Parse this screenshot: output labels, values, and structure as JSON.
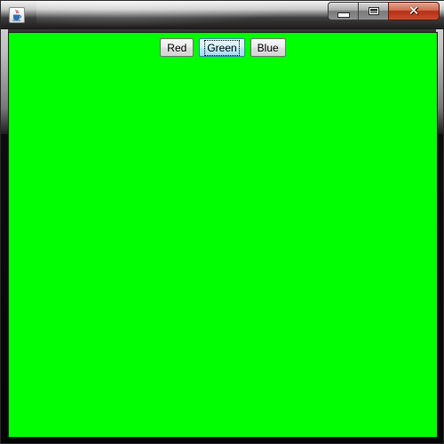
{
  "window": {
    "title": "",
    "icon": "java-coffee-cup-icon",
    "controls": {
      "minimize_icon": "minimize-icon",
      "maximize_icon": "maximize-icon",
      "close_icon": "close-icon",
      "close_glyph": "✕"
    }
  },
  "panel": {
    "background_color": "#00ff00"
  },
  "buttons": [
    {
      "label": "Red",
      "focused": false
    },
    {
      "label": "Green",
      "focused": true
    },
    {
      "label": "Blue",
      "focused": false
    }
  ],
  "colors": {
    "close_button": "#c84b2c",
    "focus_border": "#3c7fb1"
  }
}
